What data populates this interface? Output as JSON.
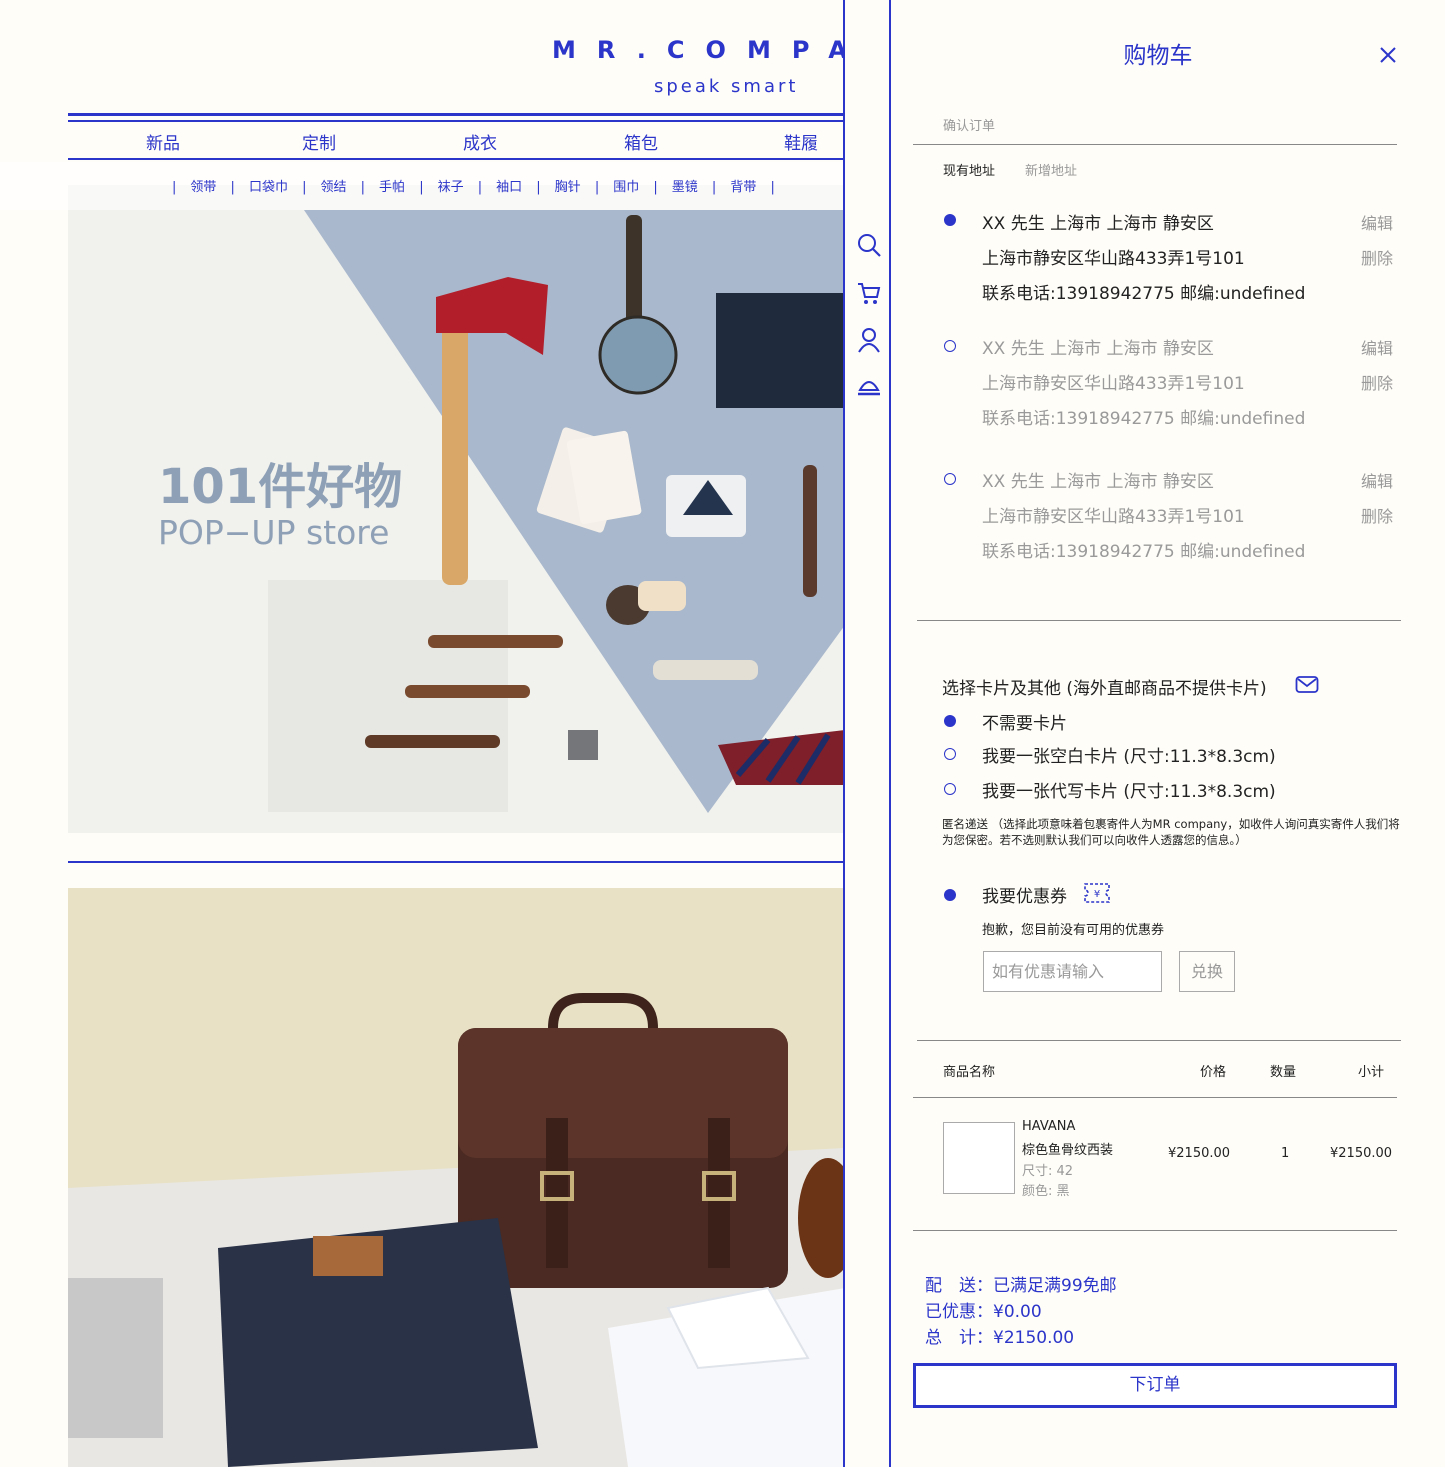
{
  "site": {
    "logo": "MR.COMPAN",
    "tagline": "speak smart",
    "nav": [
      "新品",
      "定制",
      "成衣",
      "箱包",
      "鞋履"
    ],
    "subnav": [
      "领带",
      "口袋巾",
      "领结",
      "手帕",
      "袜子",
      "袖口",
      "胸针",
      "围巾",
      "墨镜",
      "背带"
    ],
    "banner_title": "101件好物",
    "banner_subtitle": "POP−UP store"
  },
  "rail": {
    "icons": [
      "search-icon",
      "cart-icon",
      "user-icon",
      "service-bell-icon"
    ]
  },
  "cart": {
    "title": "购物车",
    "close_icon": "close-icon",
    "confirm_order": "确认订单",
    "address_tabs": [
      "现有地址",
      "新增地址"
    ],
    "addresses": [
      {
        "line1": "XX 先生 上海市 上海市 静安区",
        "line2": "上海市静安区华山路433弄1号101",
        "line3": "联系电话:13918942775 邮编:undefined",
        "selected": true
      },
      {
        "line1": "XX 先生 上海市 上海市 静安区",
        "line2": "上海市静安区华山路433弄1号101",
        "line3": "联系电话:13918942775 邮编:undefined",
        "selected": false
      },
      {
        "line1": "XX 先生 上海市 上海市 静安区",
        "line2": "上海市静安区华山路433弄1号101",
        "line3": "联系电话:13918942775 邮编:undefined",
        "selected": false
      }
    ],
    "edit_label": "编辑",
    "delete_label": "删除",
    "card_section_title": "选择卡片及其他 (海外直邮商品不提供卡片)",
    "card_options": [
      {
        "label": "不需要卡片",
        "selected": true
      },
      {
        "label": "我要一张空白卡片  (尺寸:11.3*8.3cm)",
        "selected": false
      },
      {
        "label": "我要一张代写卡片  (尺寸:11.3*8.3cm)",
        "selected": false
      }
    ],
    "anonymous_note": "匿名递送 （选择此项意味着包裹寄件人为MR company，如收件人询问真实寄件人我们将为您保密。若不选则默认我们可以向收件人透露您的信息。）",
    "coupon_label": "我要优惠券",
    "coupon_empty": "抱歉，您目前没有可用的优惠券",
    "coupon_placeholder": "如有优惠请输入",
    "coupon_button": "兑换",
    "table_headers": {
      "name": "商品名称",
      "price": "价格",
      "qty": "数量",
      "subtotal": "小计"
    },
    "items": [
      {
        "brand": "HAVANA",
        "name": "棕色鱼骨纹西装",
        "size": "尺寸: 42",
        "color": "颜色: 黑",
        "price": "¥2150.00",
        "qty": "1",
        "subtotal": "¥2150.00"
      }
    ],
    "shipping": "配　送：已满足满99免邮",
    "discount": "已优惠：¥0.00",
    "total": "总　计：¥2150.00",
    "order_button": "下订单",
    "accent_color": "#2c35c9"
  }
}
